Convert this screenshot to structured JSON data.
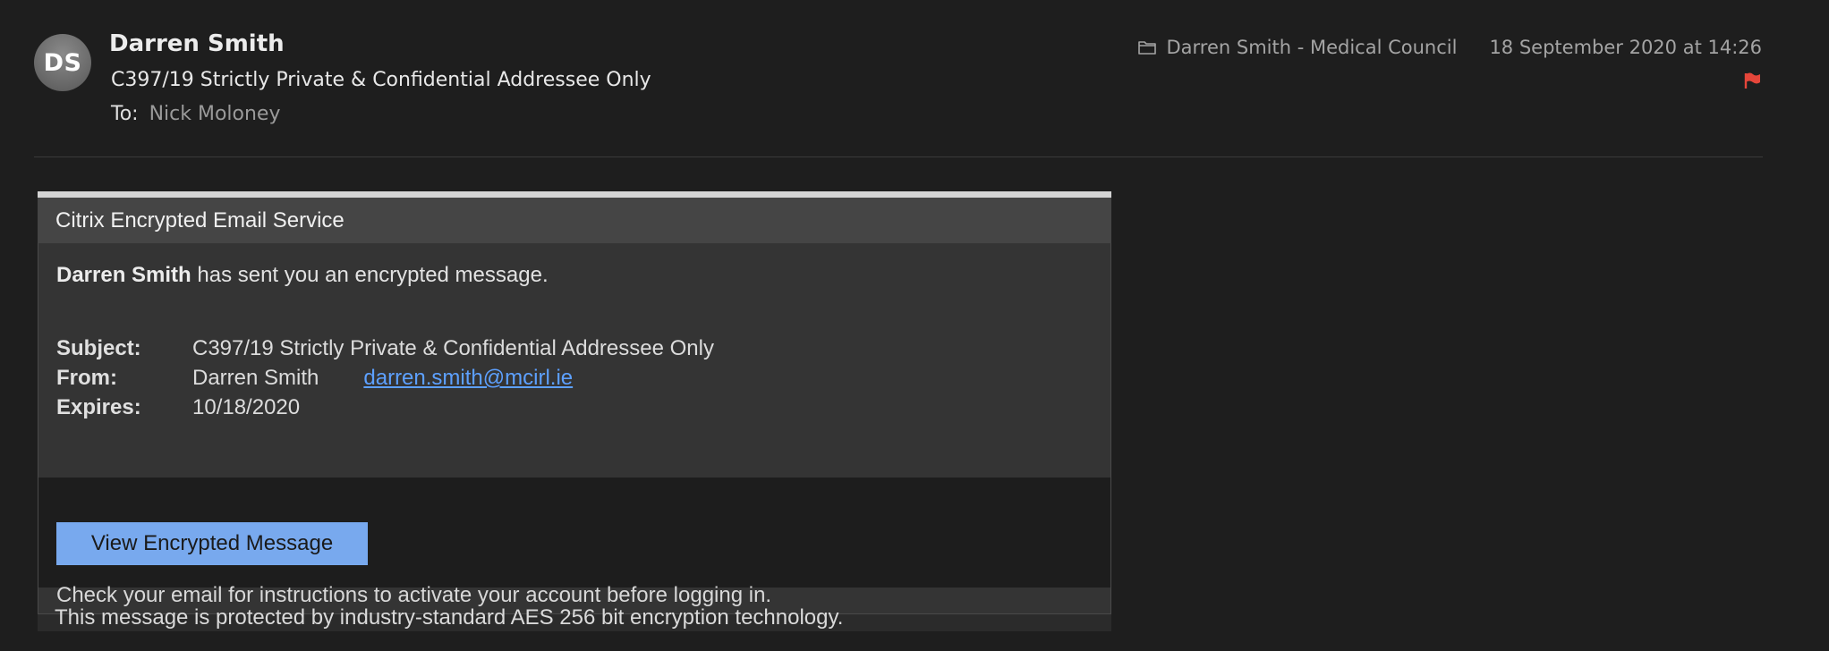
{
  "sender": {
    "initials": "DS",
    "name": "Darren Smith"
  },
  "message": {
    "subject": "C397/19 Strictly Private & Confidential Addressee Only",
    "to_label": "To:",
    "to_value": "Nick Moloney",
    "folder": "Darren Smith - Medical Council",
    "date": "18 September 2020 at 14:26"
  },
  "icons": {
    "folder": "folder-icon",
    "flag": "flag-icon",
    "flag_color": "#e5463a"
  },
  "card": {
    "title": "Citrix Encrypted Email Service",
    "intro_name": "Darren Smith",
    "intro_rest": " has sent you an encrypted message.",
    "subject_label": "Subject:",
    "subject_value": "C397/19 Strictly Private & Confidential Addressee Only",
    "from_label": "From:",
    "from_name": "Darren Smith",
    "from_email": "darren.smith@mcirl.ie",
    "expires_label": "Expires:",
    "expires_value": "10/18/2020",
    "button_label": "View Encrypted Message",
    "instructions": "Check your email for instructions to activate your account before logging in.",
    "footer": "This message is protected by industry-standard AES 256 bit encryption technology."
  },
  "colors": {
    "background": "#1e1e1e",
    "button": "#78a9ee",
    "link": "#5da0ff"
  }
}
